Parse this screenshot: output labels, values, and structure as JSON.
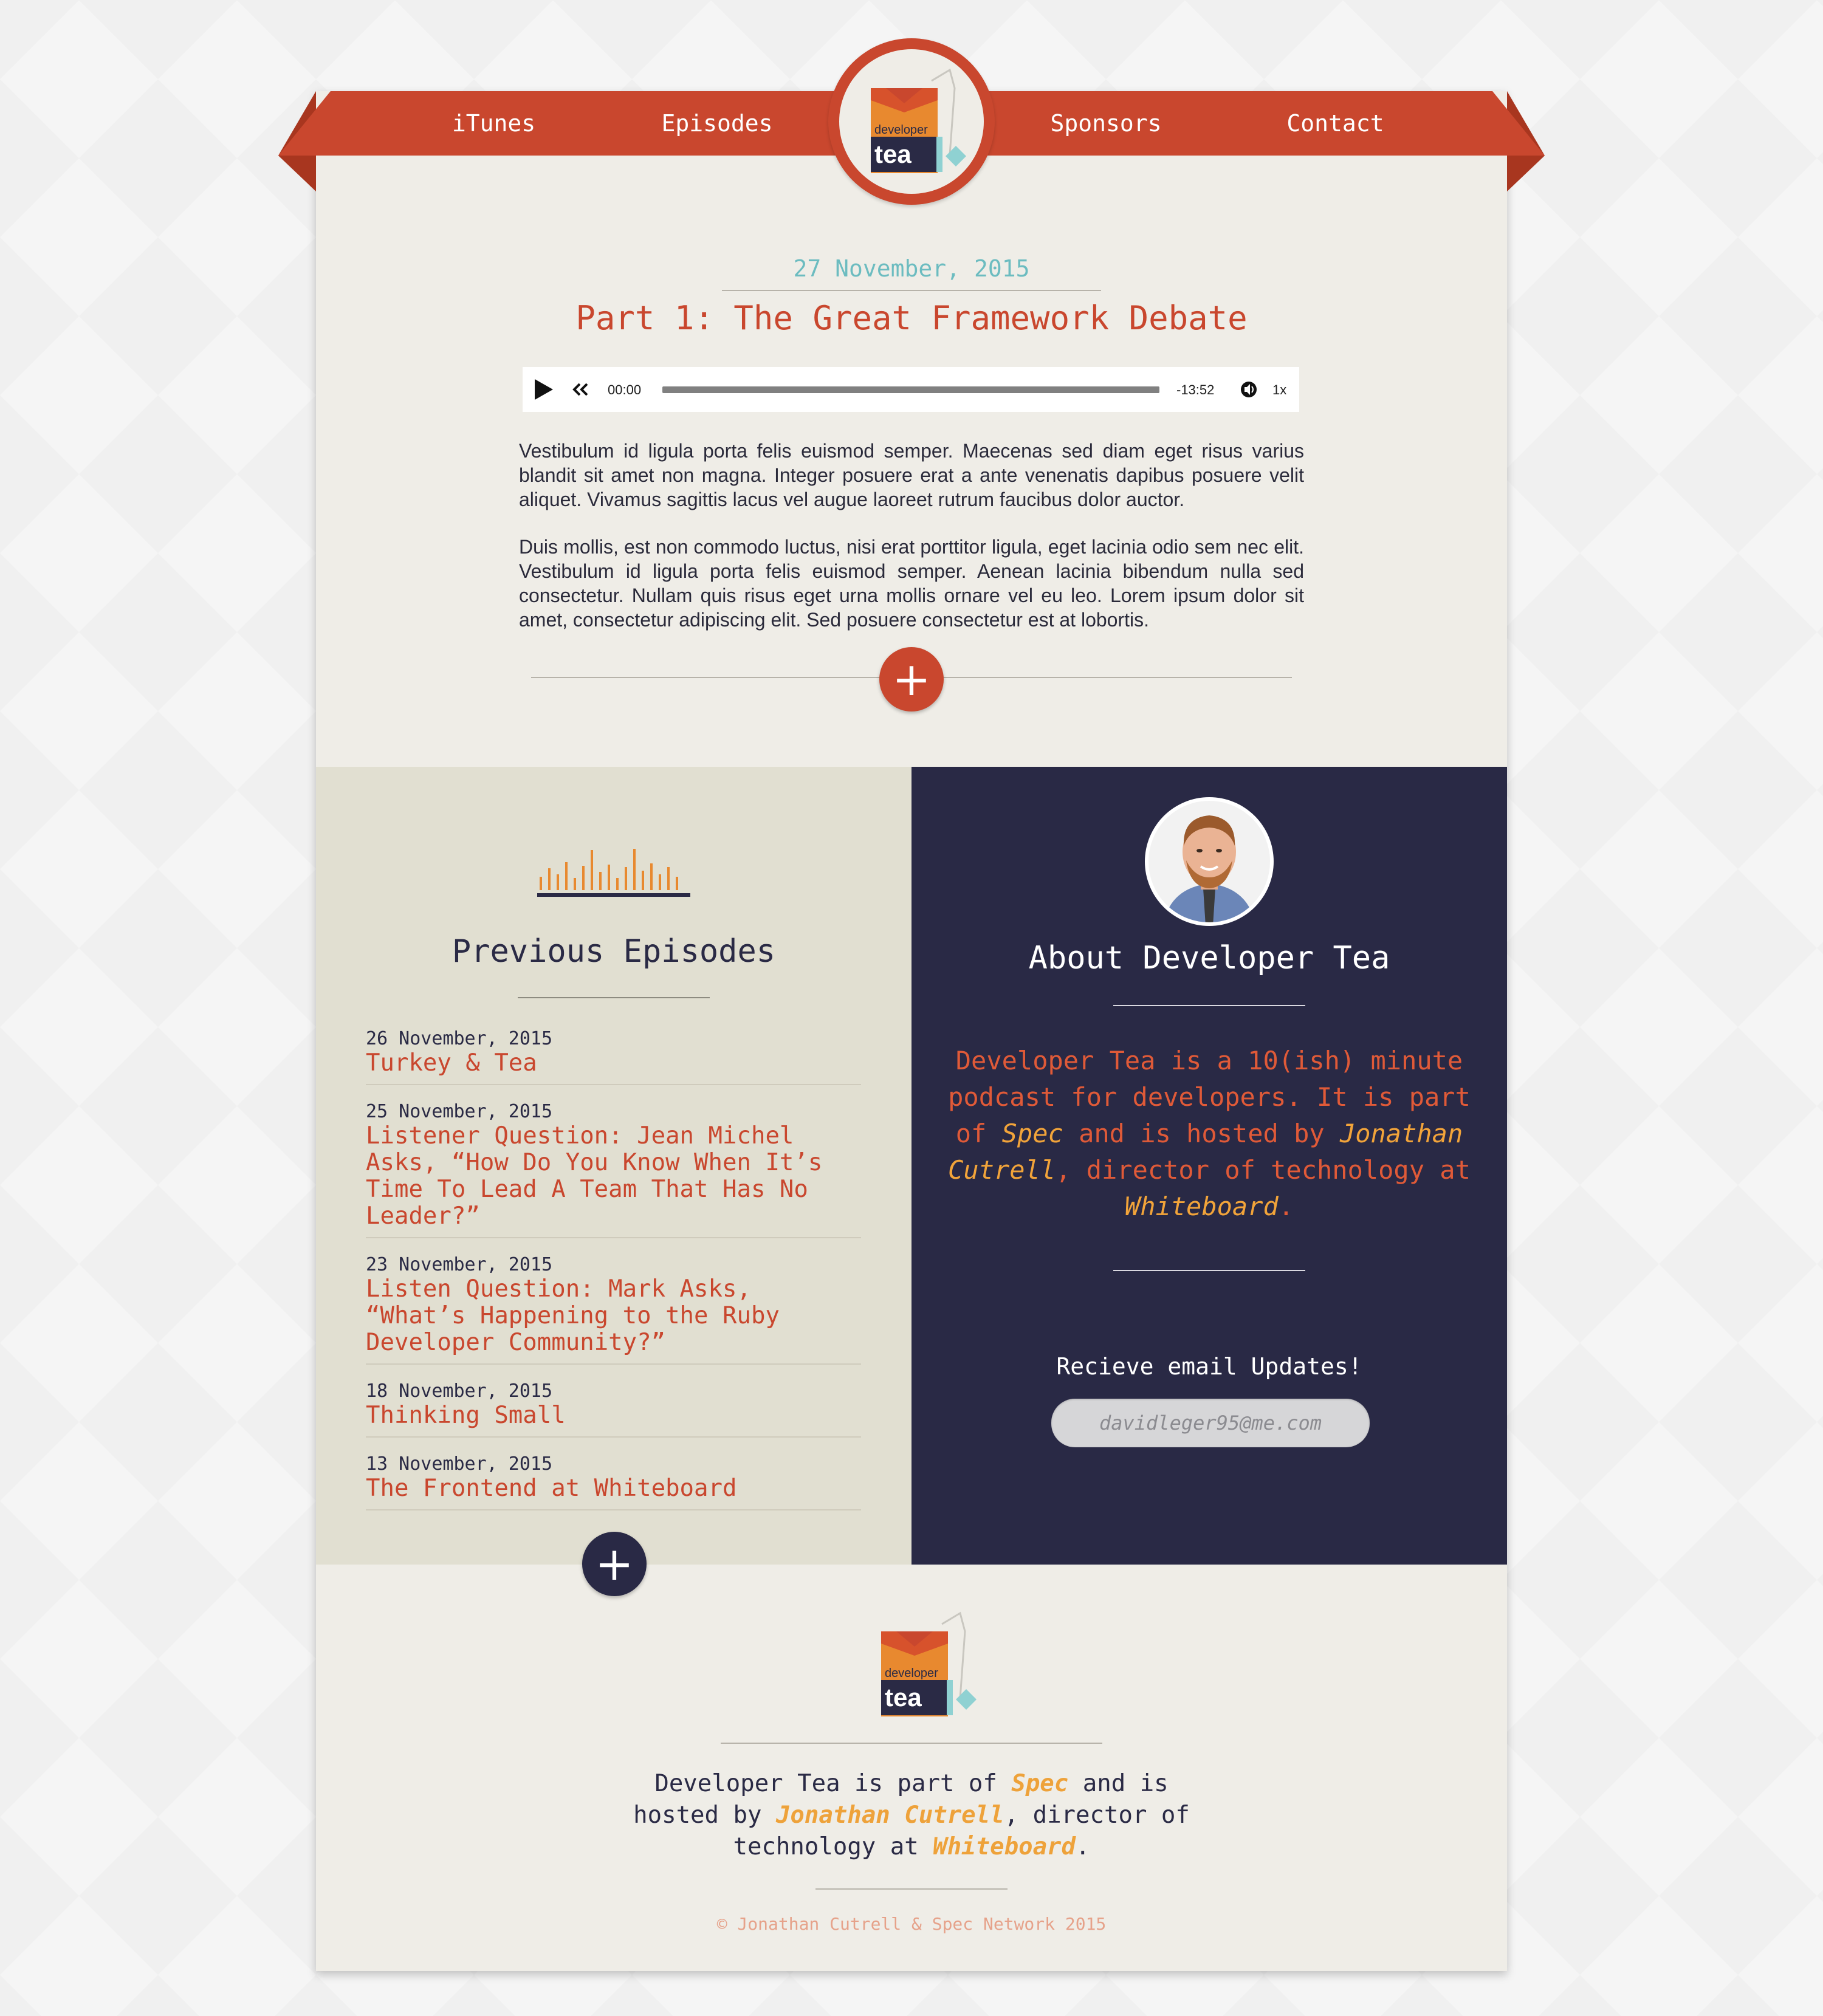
{
  "nav": {
    "items": [
      "iTunes",
      "Episodes",
      "Sponsors",
      "Contact"
    ],
    "logo_text_top": "developer",
    "logo_text_bottom": "tea"
  },
  "featured": {
    "date": "27 November, 2015",
    "title": "Part 1: The Great Framework Debate",
    "player": {
      "current_time": "00:00",
      "remaining_time": "-13:52",
      "speed": "1x",
      "progress": 0
    },
    "description": [
      "Vestibulum id ligula porta felis euismod semper. Maecenas sed diam eget risus varius blandit sit amet non magna. Integer posuere erat a ante venenatis dapibus posuere velit aliquet. Vivamus sagittis lacus vel augue laoreet rutrum faucibus dolor auctor.",
      "Duis mollis, est non commodo luctus, nisi erat porttitor ligula, eget lacinia odio sem nec elit. Vestibulum id ligula porta felis euismod semper. Aenean lacinia bibendum nulla sed consectetur. Nullam quis risus eget urna mollis ornare vel eu leo. Lorem ipsum dolor sit amet, consectetur adipiscing elit. Sed posuere consectetur est at lobortis."
    ],
    "expand_symbol": "+"
  },
  "previous": {
    "title": "Previous Episodes",
    "episodes": [
      {
        "date": "26 November, 2015",
        "title": "Turkey & Tea"
      },
      {
        "date": "25 November, 2015",
        "title": "Listener Question: Jean Michel Asks, “How Do You Know When It’s Time To Lead A Team That Has No Leader?”"
      },
      {
        "date": "23 November, 2015",
        "title": "Listen Question: Mark Asks, “What’s Happening to the Ruby Developer Community?”"
      },
      {
        "date": "18 November, 2015",
        "title": "Thinking Small"
      },
      {
        "date": "13 November, 2015",
        "title": "The Frontend at Whiteboard"
      }
    ],
    "more_symbol": "+"
  },
  "about": {
    "title": "About Developer Tea",
    "text_1": "Developer Tea is a 10(ish) minute podcast for developers. It is part of ",
    "link_spec": "Spec",
    "text_2": " and is hosted by ",
    "link_host": "Jonathan Cutrell",
    "text_3": ", director of technology at ",
    "link_company": "Whiteboard",
    "text_4": ".",
    "subscribe_label": "Recieve email Updates!",
    "email_placeholder": "davidleger95@me.com"
  },
  "footer": {
    "text_1": "Developer Tea is part of ",
    "link_spec": "Spec",
    "text_2": " and is hosted by ",
    "link_host": "Jonathan Cutrell",
    "text_3": ", director of technology at ",
    "link_company": "Whiteboard",
    "text_4": ".",
    "copyright": "© Jonathan Cutrell & Spec Network 2015"
  },
  "colors": {
    "brand_red": "#c9472e",
    "accent_orange": "#eea23a",
    "teal": "#6cbcc0",
    "navy": "#292945",
    "cream": "#efede7",
    "beige": "#e1dfd1"
  }
}
